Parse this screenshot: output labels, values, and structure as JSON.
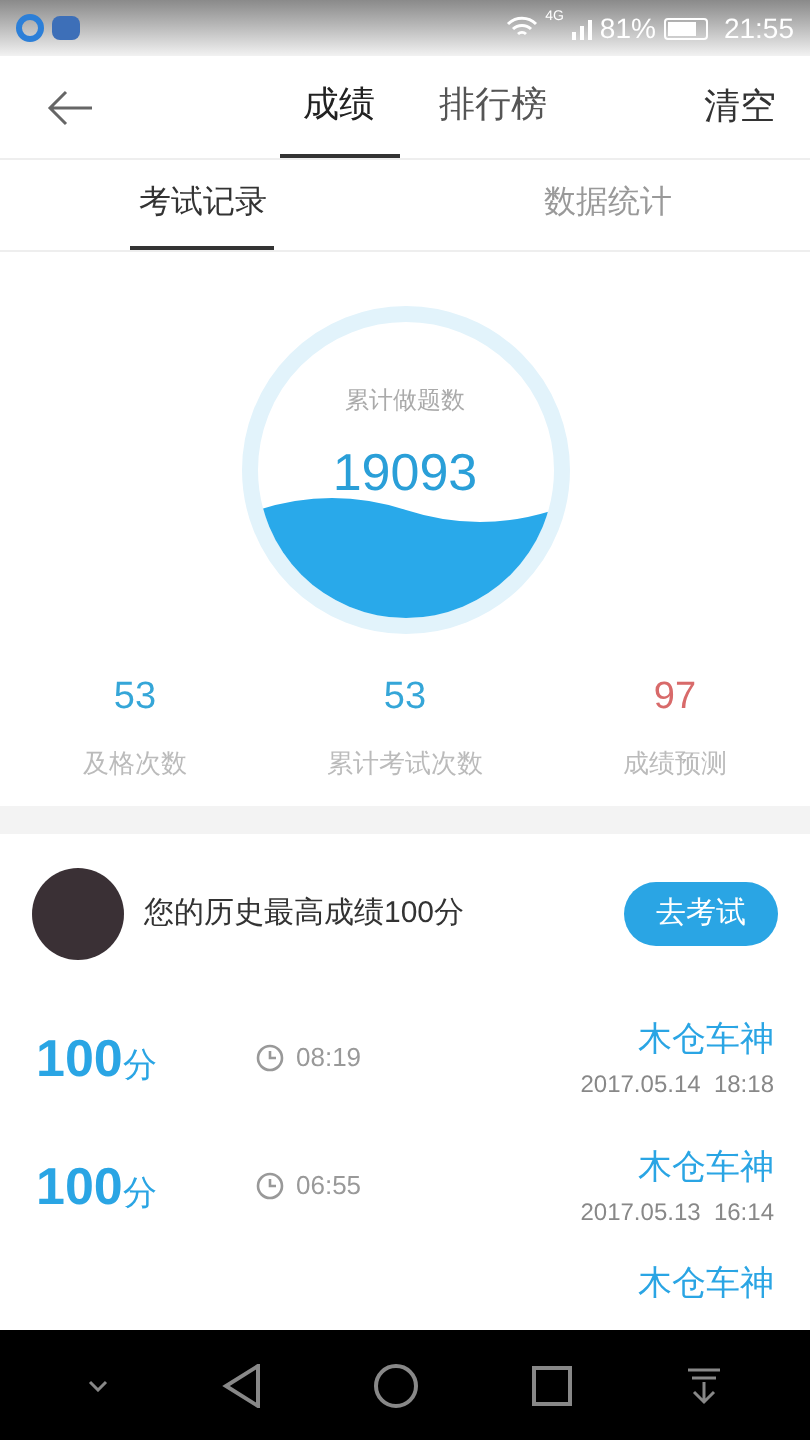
{
  "status_bar": {
    "network": "4G",
    "battery": "81%",
    "time": "21:55"
  },
  "header": {
    "tabs": [
      {
        "label": "成绩",
        "selected": true
      },
      {
        "label": "排行榜",
        "selected": false
      }
    ],
    "action": "清空"
  },
  "sub_tabs": [
    {
      "label": "考试记录",
      "selected": true
    },
    {
      "label": "数据统计",
      "selected": false
    }
  ],
  "gauge": {
    "label": "累计做题数",
    "value": "19093"
  },
  "stats": [
    {
      "value": "53",
      "label": "及格次数",
      "color": "#35a6d8"
    },
    {
      "value": "53",
      "label": "累计考试次数",
      "color": "#35a6d8"
    },
    {
      "value": "97",
      "label": "成绩预测",
      "color": "#d86a6a"
    }
  ],
  "best": {
    "text": "您的历史最高成绩100分",
    "button": "去考试"
  },
  "records": [
    {
      "score": "100",
      "unit": "分",
      "duration": "08:19",
      "name": "木仓车神",
      "date": "2017.05.14  18:18"
    },
    {
      "score": "100",
      "unit": "分",
      "duration": "06:55",
      "name": "木仓车神",
      "date": "2017.05.13  16:14"
    },
    {
      "name": "木仓车神"
    }
  ]
}
